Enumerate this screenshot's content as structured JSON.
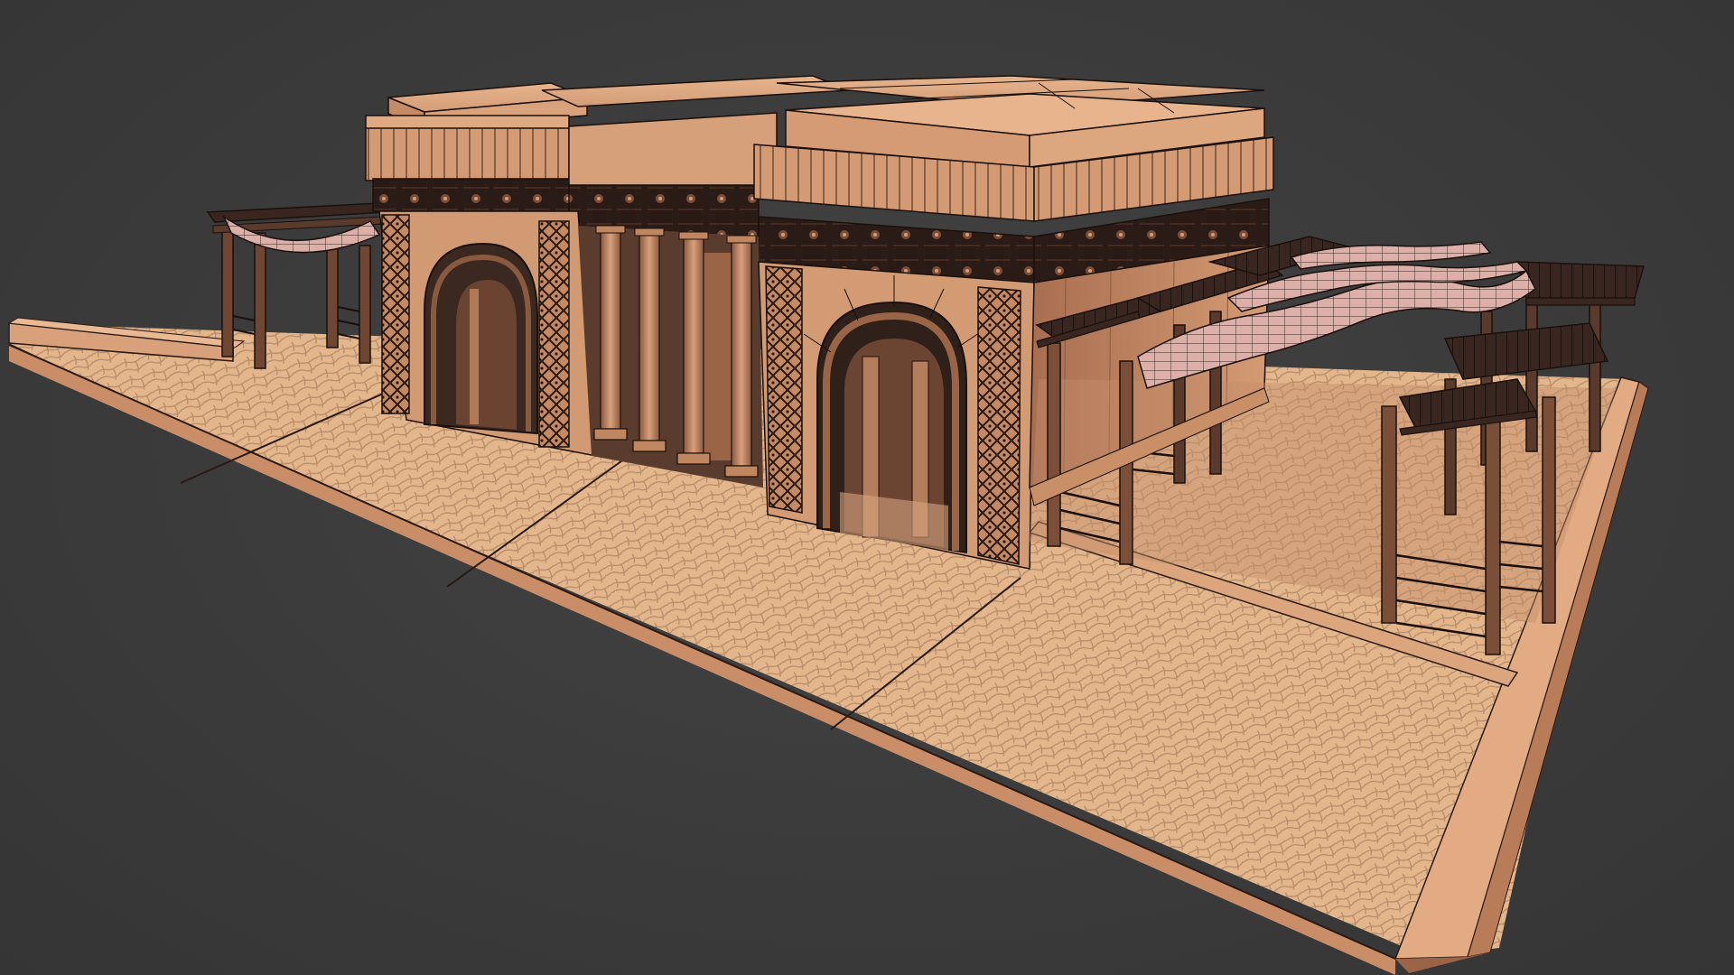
{
  "viewport": {
    "background_color": "#3a3a3a",
    "model_subject": "desert-arch-pavilion"
  },
  "palette": {
    "stone": "#d9a07a",
    "stone_dark": "#b67d5a",
    "stone_shadow": "#8a5a40",
    "wood_dark": "#2e1e18",
    "frieze": "#2a1a16",
    "paving": "#e2b58a",
    "wire": "#1a120e"
  },
  "icons": {
    "model": "pavilion-3d-model-icon"
  }
}
